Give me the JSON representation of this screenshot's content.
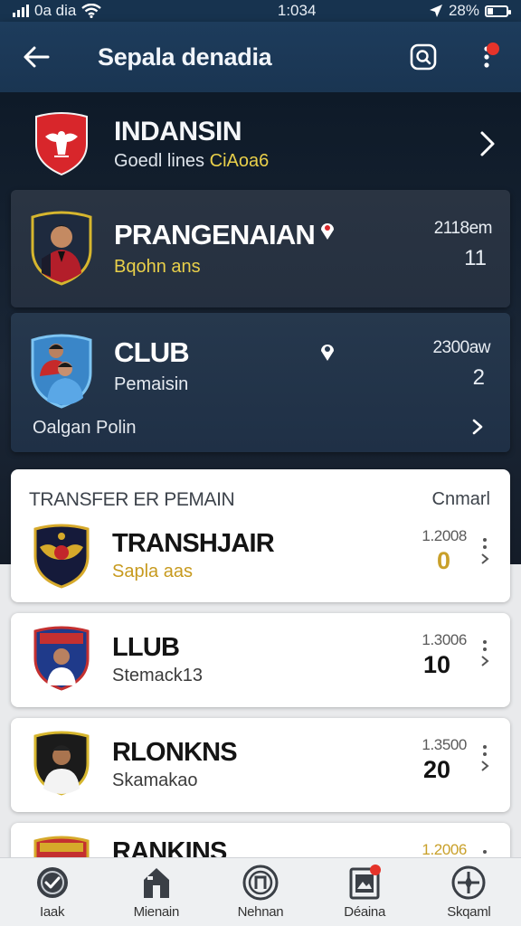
{
  "status_bar": {
    "carrier": "0a dia",
    "time": "1:034",
    "battery": "28%",
    "battery_level": 0.28
  },
  "header": {
    "title": "Sepala denadia",
    "colors": {
      "background": "#1d3c5c",
      "notification": "#e5332a"
    }
  },
  "league": {
    "name": "INDANSIN",
    "subtitle_prefix": "Goedl lines",
    "subtitle_accent": "CiAoa6"
  },
  "cards": [
    {
      "title": "PRANGENAIAN",
      "subtitle": "Bqohn ans",
      "stat_top": "2118em",
      "stat_big": "11",
      "subtitle_color": "#e9d04a"
    },
    {
      "title": "CLUB",
      "subtitle": "Pemaisin",
      "stat_top": "2300aw",
      "stat_big": "2",
      "footer": "Oalgan Polin"
    }
  ],
  "transfer": {
    "section_label": "TRANSFER ER PEMAIN",
    "section_action": "Cnmarl",
    "rows": [
      {
        "title": "TRANSHJAIR",
        "subtitle": "Sapla aas",
        "small": "1.2008",
        "big": "0",
        "gold": true
      },
      {
        "title": "LLUB",
        "subtitle": "Stemack13",
        "small": "1.3006",
        "big": "10",
        "gold": false
      },
      {
        "title": "RLONKNS",
        "subtitle": "Skamakao",
        "small": "1.3500",
        "big": "20",
        "gold": false
      },
      {
        "title": "RANKINS",
        "subtitle": "",
        "small": "1.2006",
        "big": "",
        "gold": true
      }
    ]
  },
  "bottom_nav": [
    {
      "label": "Iaak",
      "icon": "check-circle-icon"
    },
    {
      "label": "Mienain",
      "icon": "home-icon"
    },
    {
      "label": "Nehnan",
      "icon": "news-circle-icon"
    },
    {
      "label": "Déaina",
      "icon": "clipboard-icon"
    },
    {
      "label": "Skqaml",
      "icon": "compass-icon"
    }
  ]
}
